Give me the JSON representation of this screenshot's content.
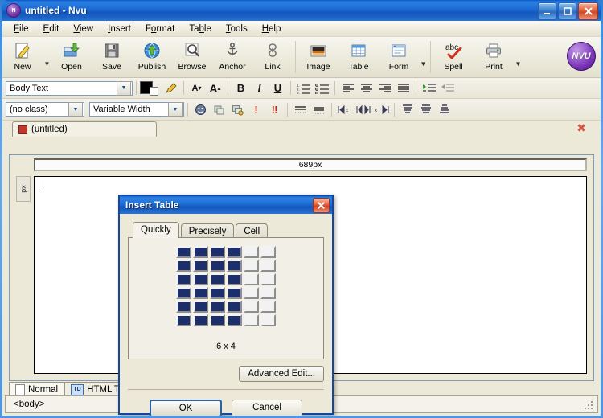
{
  "window": {
    "title": "untitled - Nvu",
    "app_icon": "nvu-icon",
    "buttons": {
      "minimize": "–",
      "maximize": "□",
      "close": "✕"
    }
  },
  "menubar": {
    "items": [
      {
        "label": "File",
        "accel": "F"
      },
      {
        "label": "Edit",
        "accel": "E"
      },
      {
        "label": "View",
        "accel": "V"
      },
      {
        "label": "Insert",
        "accel": "I"
      },
      {
        "label": "Format",
        "accel": "o"
      },
      {
        "label": "Table",
        "accel": "b"
      },
      {
        "label": "Tools",
        "accel": "T"
      },
      {
        "label": "Help",
        "accel": "H"
      }
    ]
  },
  "toolbar": {
    "buttons": [
      {
        "label": "New",
        "icon": "new-page-icon",
        "has_dropdown": true
      },
      {
        "label": "Open",
        "icon": "open-folder-icon",
        "has_dropdown": false
      },
      {
        "label": "Save",
        "icon": "floppy-disk-icon",
        "has_dropdown": false
      },
      {
        "label": "Publish",
        "icon": "globe-upload-icon",
        "has_dropdown": false
      },
      {
        "label": "Browse",
        "icon": "magnifier-icon",
        "has_dropdown": false
      },
      {
        "label": "Anchor",
        "icon": "anchor-icon",
        "has_dropdown": false
      },
      {
        "label": "Link",
        "icon": "chain-link-icon",
        "has_dropdown": false
      },
      {
        "label": "Image",
        "icon": "picture-icon",
        "has_dropdown": false
      },
      {
        "label": "Table",
        "icon": "table-grid-icon",
        "has_dropdown": false
      },
      {
        "label": "Form",
        "icon": "form-window-icon",
        "has_dropdown": true
      },
      {
        "label": "Spell",
        "icon": "abc-check-icon",
        "has_dropdown": false
      },
      {
        "label": "Print",
        "icon": "printer-icon",
        "has_dropdown": true
      }
    ],
    "logo": "NVU"
  },
  "format_bar": {
    "paragraph_style": "Body Text",
    "class_select": "(no class)",
    "font_select": "Variable Width",
    "color_swatch": "#000000",
    "buttons": [
      {
        "name": "text-color-swatch",
        "glyph": ""
      },
      {
        "name": "highlight-pen-icon",
        "glyph": "🖉"
      },
      {
        "name": "decrease-font-size-button",
        "glyph": "A▾"
      },
      {
        "name": "increase-font-size-button",
        "glyph": "A▴"
      },
      {
        "name": "bold-button",
        "glyph": "B"
      },
      {
        "name": "italic-button",
        "glyph": "I"
      },
      {
        "name": "underline-button",
        "glyph": "U"
      },
      {
        "name": "numbered-list-button",
        "glyph": "≔"
      },
      {
        "name": "bulleted-list-button",
        "glyph": "☰"
      },
      {
        "name": "align-left-button",
        "glyph": "▤"
      },
      {
        "name": "align-center-button",
        "glyph": "▥"
      },
      {
        "name": "align-right-button",
        "glyph": "▦"
      },
      {
        "name": "justify-button",
        "glyph": "▧"
      },
      {
        "name": "indent-button",
        "glyph": "⇥"
      },
      {
        "name": "outdent-button",
        "glyph": "⇤"
      }
    ],
    "row2_buttons": [
      {
        "name": "smiley-icon",
        "glyph": "☻"
      },
      {
        "name": "layer-icon",
        "glyph": "▣"
      },
      {
        "name": "layer-add-icon",
        "glyph": "▤"
      },
      {
        "name": "important-icon",
        "glyph": "!"
      },
      {
        "name": "very-important-icon",
        "glyph": "‼"
      },
      {
        "name": "line-above-icon",
        "glyph": "≡"
      },
      {
        "name": "line-below-icon",
        "glyph": "≡"
      },
      {
        "name": "char-left-icon",
        "glyph": "◂▪"
      },
      {
        "name": "char-both-icon",
        "glyph": "◂▸"
      },
      {
        "name": "char-right-icon",
        "glyph": "▪▸"
      },
      {
        "name": "anchor-top-icon",
        "glyph": "▩"
      },
      {
        "name": "anchor-middle-icon",
        "glyph": "▩"
      },
      {
        "name": "anchor-bottom-icon",
        "glyph": "▩"
      }
    ]
  },
  "doc_tab": {
    "label": "(untitled)",
    "modified_marker": "unsaved-dot",
    "close_label": "✖"
  },
  "ruler": {
    "width_label": "689px",
    "vertical_label": "px"
  },
  "mode_tabs": [
    {
      "label": "Normal",
      "icon": "page-icon",
      "active": true
    },
    {
      "label": "HTML Ta",
      "icon": "td-tag-icon",
      "active": false
    }
  ],
  "statusbar": {
    "text": "<body>"
  },
  "dialog": {
    "title": "Insert Table",
    "close_label": "✕",
    "tabs": [
      {
        "label": "Quickly",
        "active": true
      },
      {
        "label": "Precisely",
        "active": false
      },
      {
        "label": "Cell",
        "active": false
      }
    ],
    "grid": {
      "rows": 6,
      "cols": 6,
      "selected_rows": 6,
      "selected_cols": 4,
      "size_label": "6 x 4",
      "selected_color": "#1d2f6b",
      "empty_color": "#f2f2f2"
    },
    "advanced_button": "Advanced Edit...",
    "ok_button": "OK",
    "cancel_button": "Cancel"
  }
}
